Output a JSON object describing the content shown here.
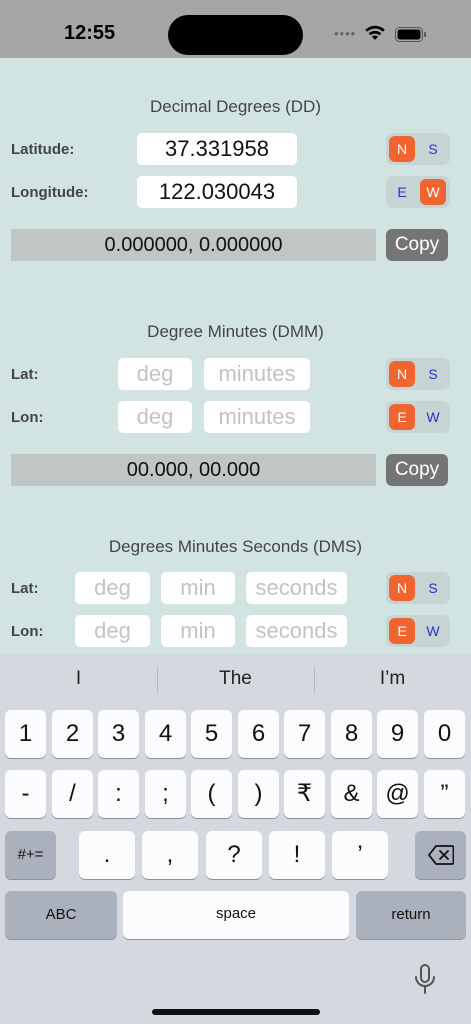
{
  "status_bar": {
    "time": "12:55",
    "signal_text": "••••"
  },
  "dd": {
    "title": "Decimal Degrees (DD)",
    "lat_label": "Latitude:",
    "lon_label": "Longitude:",
    "lat_value": "37.331958",
    "lon_value": "122.030043",
    "lat_ns": {
      "first": "N",
      "second": "S",
      "selected": "N"
    },
    "lon_ew": {
      "first": "E",
      "second": "W",
      "selected": "W"
    },
    "result": "0.000000, 0.000000",
    "copy_label": "Copy"
  },
  "dmm": {
    "title": "Degree Minutes (DMM)",
    "lat_label": "Lat:",
    "lon_label": "Lon:",
    "deg_placeholder": "deg",
    "minutes_placeholder": "minutes",
    "lat_ns": {
      "first": "N",
      "second": "S",
      "selected": "N"
    },
    "lon_ew": {
      "first": "E",
      "second": "W",
      "selected": "E"
    },
    "result": "00.000, 00.000",
    "copy_label": "Copy"
  },
  "dms": {
    "title": "Degrees Minutes Seconds (DMS)",
    "lat_label": "Lat:",
    "lon_label": "Lon:",
    "deg_placeholder": "deg",
    "min_placeholder": "min",
    "seconds_placeholder": "seconds",
    "lat_ns": {
      "first": "N",
      "second": "S",
      "selected": "N"
    },
    "lon_ew": {
      "first": "E",
      "second": "W",
      "selected": "E"
    }
  },
  "keyboard": {
    "suggestions": [
      "I",
      "The",
      "I’m"
    ],
    "row1": [
      "1",
      "2",
      "3",
      "4",
      "5",
      "6",
      "7",
      "8",
      "9",
      "0"
    ],
    "row2": [
      "-",
      "/",
      ":",
      ";",
      "(",
      ")",
      "₹",
      "&",
      "@",
      "”"
    ],
    "row3": [
      ".",
      ",",
      "?",
      "!",
      "’"
    ],
    "symbols_key": "#+=",
    "abc_key": "ABC",
    "space_key": "space",
    "return_key": "return"
  },
  "colors": {
    "accent": "#f06430",
    "background": "#d2e4e1",
    "segment_text": "#2433d6"
  }
}
